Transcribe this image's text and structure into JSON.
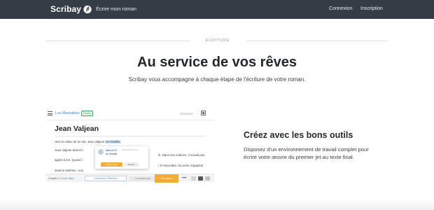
{
  "nav": {
    "brand": "Scribay",
    "write_link": "Écrire mon roman",
    "login": "Connexion",
    "signup": "Inscription"
  },
  "hero": {
    "section_label": "ÉCRITURE",
    "title": "Au service de vos rêves",
    "subtitle": "Scribay vous accompagne à chaque étape de l'écriture de votre roman."
  },
  "editor": {
    "book_title": "Les Misérables",
    "badge": "Public",
    "structure": "Structure",
    "chapter_title": "Jean Valjean",
    "para1_before": "Vers le milieu de la nuit, Jean Valjean",
    "para1_highlight": "se réveilla.",
    "para2_lines": [
      "Jean Valjean était d'u",
      "appris à lire. Quand i",
      "Jeanne Mathieu ; son",
      "contraction de Voilà j"
    ],
    "para2_tails": [
      "le. Dans  son enfance, il n'avait pas",
      "r à Faverolles. Sa mère s'appelait",
      "ean, sobriquet probablement, et"
    ],
    "comment": {
      "author": "Marcel P.",
      "date": "29/03/2017 10:13",
      "quote": "se réveilla",
      "edit_button": "Mettre à jour",
      "close_button": "Fermer"
    },
    "footer": {
      "chapter_prefix": "Chapitre 1 |",
      "chapter_link": "Jean Valje...",
      "correct_button": "Corrections / Relecture",
      "word_count": "5 | 10 354 mots",
      "status_button": "En cours",
      "more": "•••"
    }
  },
  "feature": {
    "title": "Créez avec les bons outils",
    "text_lines": [
      "Disposez d'un environnement de travail complet pour",
      "écrire votre œuvre du premier jet au texte final."
    ]
  },
  "colors": {
    "topbar": "#343d46",
    "accent_blue": "#3a8bd3",
    "accent_orange": "#f0ad3e"
  }
}
